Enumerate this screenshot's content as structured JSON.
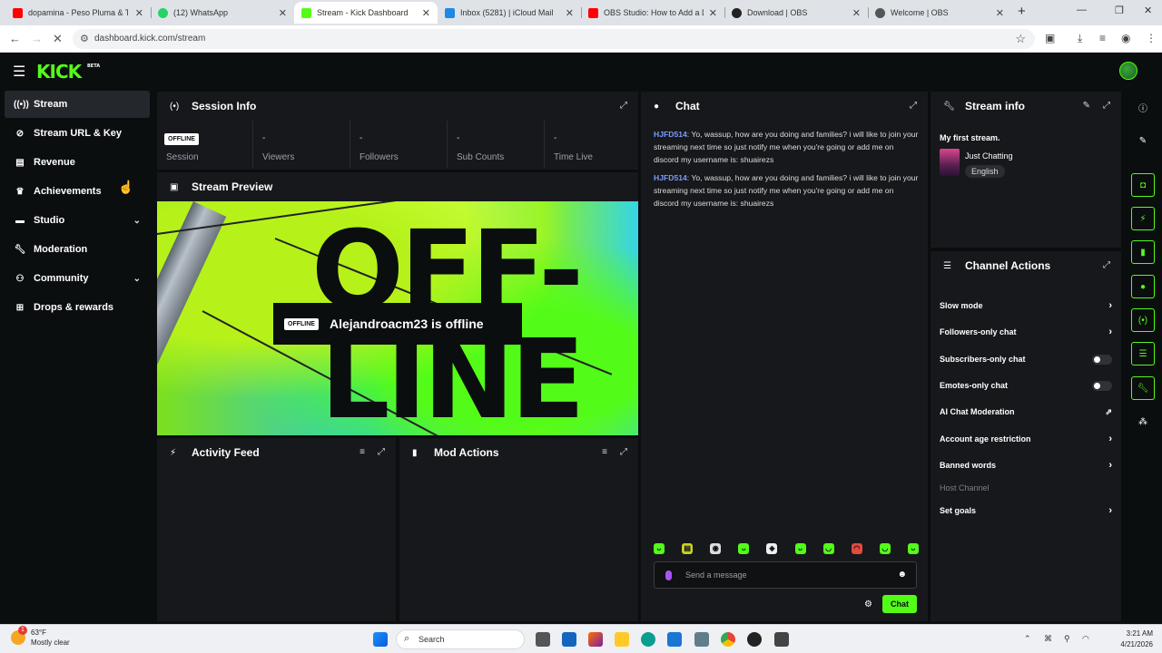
{
  "browser": {
    "tabs": [
      {
        "title": "dopamina - Peso Pluma & Tito",
        "color": "#ff0000"
      },
      {
        "title": "(12) WhatsApp",
        "color": "#25d366"
      },
      {
        "title": "Stream - Kick Dashboard",
        "color": "#53fc18"
      },
      {
        "title": "Inbox (5281) | iCloud Mail",
        "color": "#1e88e5"
      },
      {
        "title": "OBS Studio: How to Add a Disp",
        "color": "#ff0000"
      },
      {
        "title": "Download | OBS",
        "color": "#222222"
      },
      {
        "title": "Welcome | OBS",
        "color": "#555555"
      }
    ],
    "url": "dashboard.kick.com/stream"
  },
  "header": {
    "logo": "KICK",
    "logo_badge": "BETA"
  },
  "sidebar": {
    "items": [
      {
        "label": "Stream",
        "icon": "broadcast-icon"
      },
      {
        "label": "Stream URL & Key",
        "icon": "link-icon"
      },
      {
        "label": "Revenue",
        "icon": "chart-icon"
      },
      {
        "label": "Achievements",
        "icon": "trophy-icon"
      },
      {
        "label": "Studio",
        "icon": "tv-icon"
      },
      {
        "label": "Moderation",
        "icon": "wrench-icon"
      },
      {
        "label": "Community",
        "icon": "people-icon"
      },
      {
        "label": "Drops & rewards",
        "icon": "gift-icon"
      }
    ]
  },
  "session": {
    "title": "Session Info",
    "status": "OFFLINE",
    "stats": [
      {
        "label": "Session",
        "value": ""
      },
      {
        "label": "Viewers",
        "value": "-"
      },
      {
        "label": "Followers",
        "value": "-"
      },
      {
        "label": "Sub Counts",
        "value": "-"
      },
      {
        "label": "Time Live",
        "value": "-"
      }
    ]
  },
  "preview": {
    "title": "Stream Preview",
    "badge": "OFFLINE",
    "message": "Alejandroacm23 is offline"
  },
  "activity": {
    "title": "Activity Feed"
  },
  "modactions": {
    "title": "Mod Actions"
  },
  "chat": {
    "title": "Chat",
    "messages": [
      {
        "user": "HJFD514",
        "text": ": Yo, wassup, how are you doing and families? i will like to join your streaming next time so just notify me when you're going or add me on discord my username is: shuairezs"
      },
      {
        "user": "HJFD514",
        "text": ": Yo, wassup, how are you doing and families? i will like to join your streaming next time so just notify me when you're going or add me on discord my username is: shuairezs"
      }
    ],
    "placeholder": "Send a message",
    "send_label": "Chat"
  },
  "streaminfo": {
    "title": "Stream info",
    "stream_title": "My first stream.",
    "category": "Just Chatting",
    "language": "English"
  },
  "channelactions": {
    "title": "Channel Actions",
    "items": [
      {
        "label": "Slow mode",
        "control": "chevron"
      },
      {
        "label": "Followers-only chat",
        "control": "chevron"
      },
      {
        "label": "Subscribers-only chat",
        "control": "toggle"
      },
      {
        "label": "Emotes-only chat",
        "control": "toggle"
      },
      {
        "label": "AI Chat Moderation",
        "control": "external"
      },
      {
        "label": "Account age restriction",
        "control": "chevron"
      },
      {
        "label": "Banned words",
        "control": "chevron"
      },
      {
        "label": "Host Channel",
        "control": "none"
      },
      {
        "label": "Set goals",
        "control": "chevron"
      }
    ]
  },
  "taskbar": {
    "temp": "63°F",
    "condition": "Mostly clear",
    "search": "Search",
    "time": "3:21 AM",
    "date": "4/21/2026",
    "weather_badge": "1"
  },
  "colors": {
    "accent": "#53fc18",
    "panel": "#16181b",
    "bg": "#0b0e0f"
  }
}
